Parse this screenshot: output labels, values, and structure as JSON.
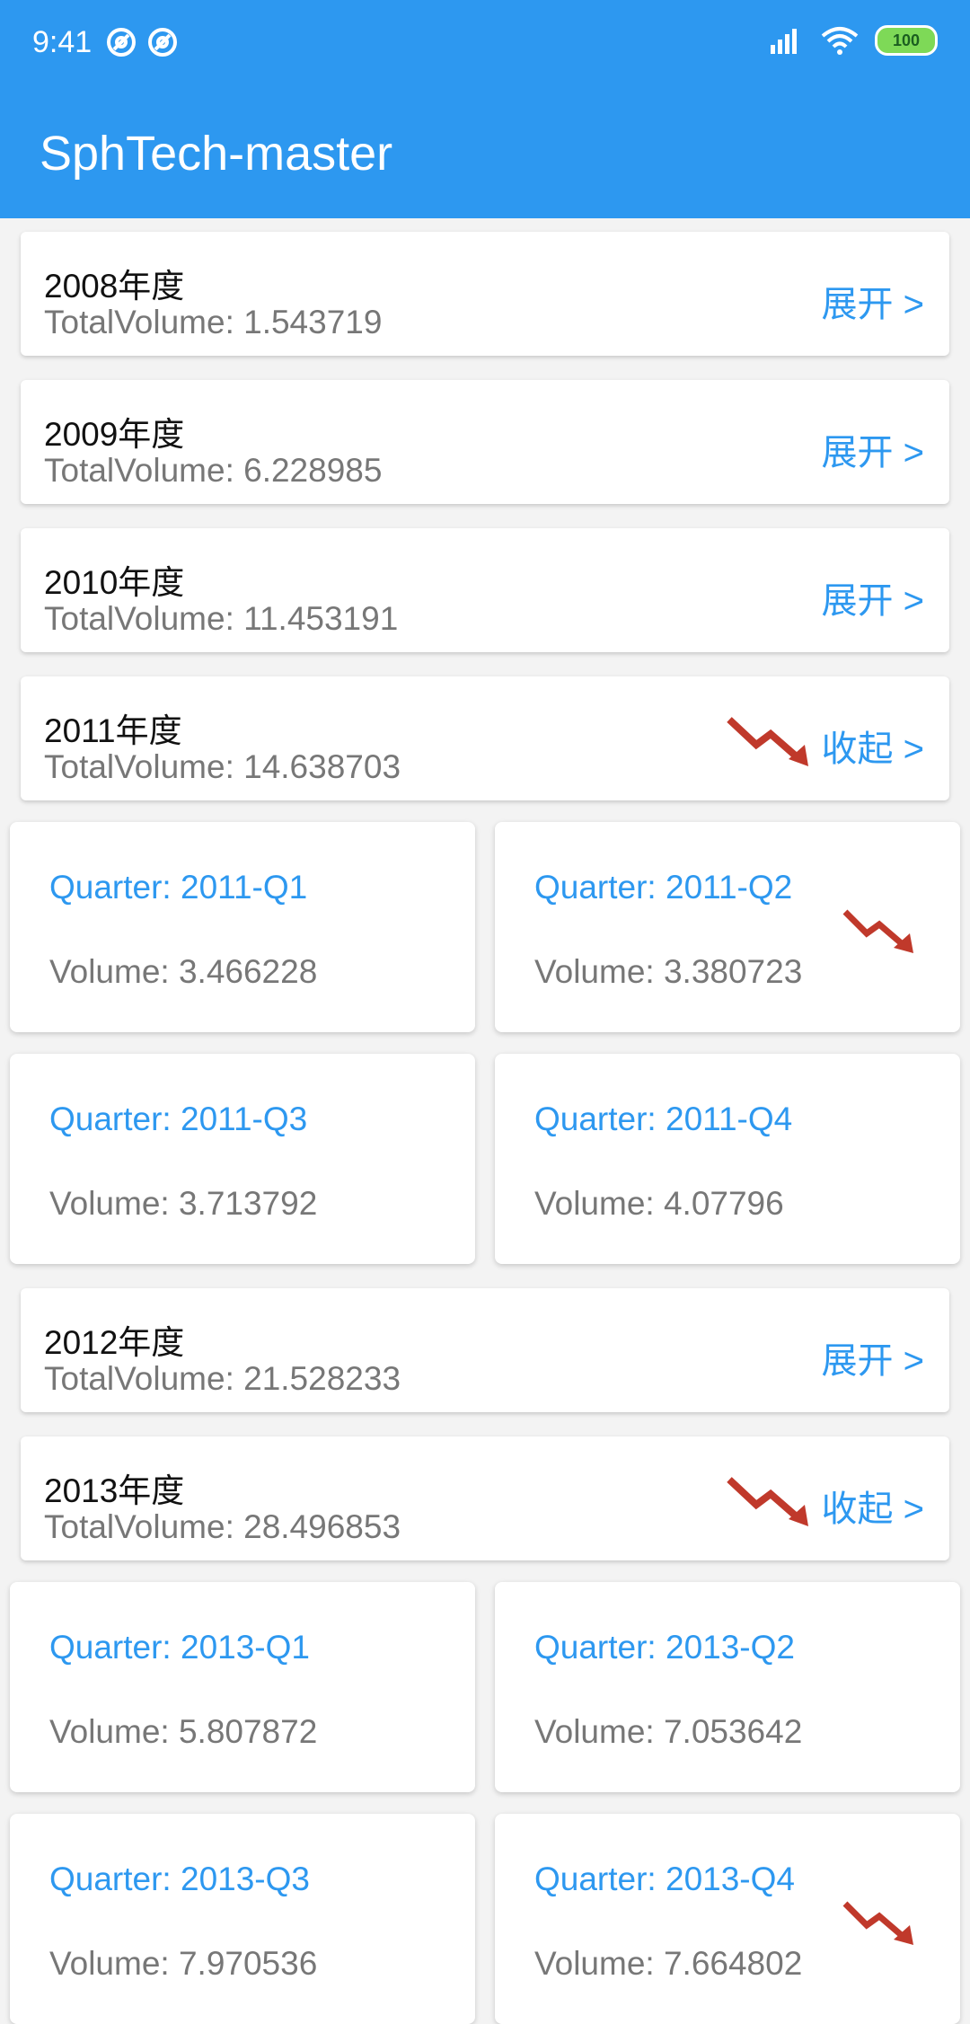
{
  "status_bar": {
    "time": "9:41",
    "icons": [
      "at-icon",
      "at-icon",
      "hd-signal-icon",
      "wifi-icon",
      "battery-icon"
    ],
    "battery": "100"
  },
  "app": {
    "title": "SphTech-master",
    "accent": "#2d98f0",
    "trend_color": "#c0392b"
  },
  "years": [
    {
      "title": "2008年度",
      "total": "TotalVolume: 1.543719",
      "toggle": "展开 >",
      "decline": false
    },
    {
      "title": "2009年度",
      "total": "TotalVolume: 6.228985",
      "toggle": "展开 >",
      "decline": false
    },
    {
      "title": "2010年度",
      "total": "TotalVolume: 11.453191",
      "toggle": "展开 >",
      "decline": false
    },
    {
      "title": "2011年度",
      "total": "TotalVolume: 14.638703",
      "toggle": "收起 >",
      "decline": true,
      "quarters": [
        {
          "label": "Quarter: 2011-Q1",
          "volume": "Volume: 3.466228",
          "decline": false
        },
        {
          "label": "Quarter: 2011-Q2",
          "volume": "Volume: 3.380723",
          "decline": true
        },
        {
          "label": "Quarter: 2011-Q3",
          "volume": "Volume: 3.713792",
          "decline": false
        },
        {
          "label": "Quarter: 2011-Q4",
          "volume": "Volume: 4.07796",
          "decline": false
        }
      ]
    },
    {
      "title": "2012年度",
      "total": "TotalVolume: 21.528233",
      "toggle": "展开 >",
      "decline": false
    },
    {
      "title": "2013年度",
      "total": "TotalVolume: 28.496853",
      "toggle": "收起 >",
      "decline": true,
      "quarters": [
        {
          "label": "Quarter: 2013-Q1",
          "volume": "Volume: 5.807872",
          "decline": false
        },
        {
          "label": "Quarter: 2013-Q2",
          "volume": "Volume: 7.053642",
          "decline": false
        },
        {
          "label": "Quarter: 2013-Q3",
          "volume": "Volume: 7.970536",
          "decline": false
        },
        {
          "label": "Quarter: 2013-Q4",
          "volume": "Volume: 7.664802",
          "decline": true
        }
      ]
    }
  ]
}
